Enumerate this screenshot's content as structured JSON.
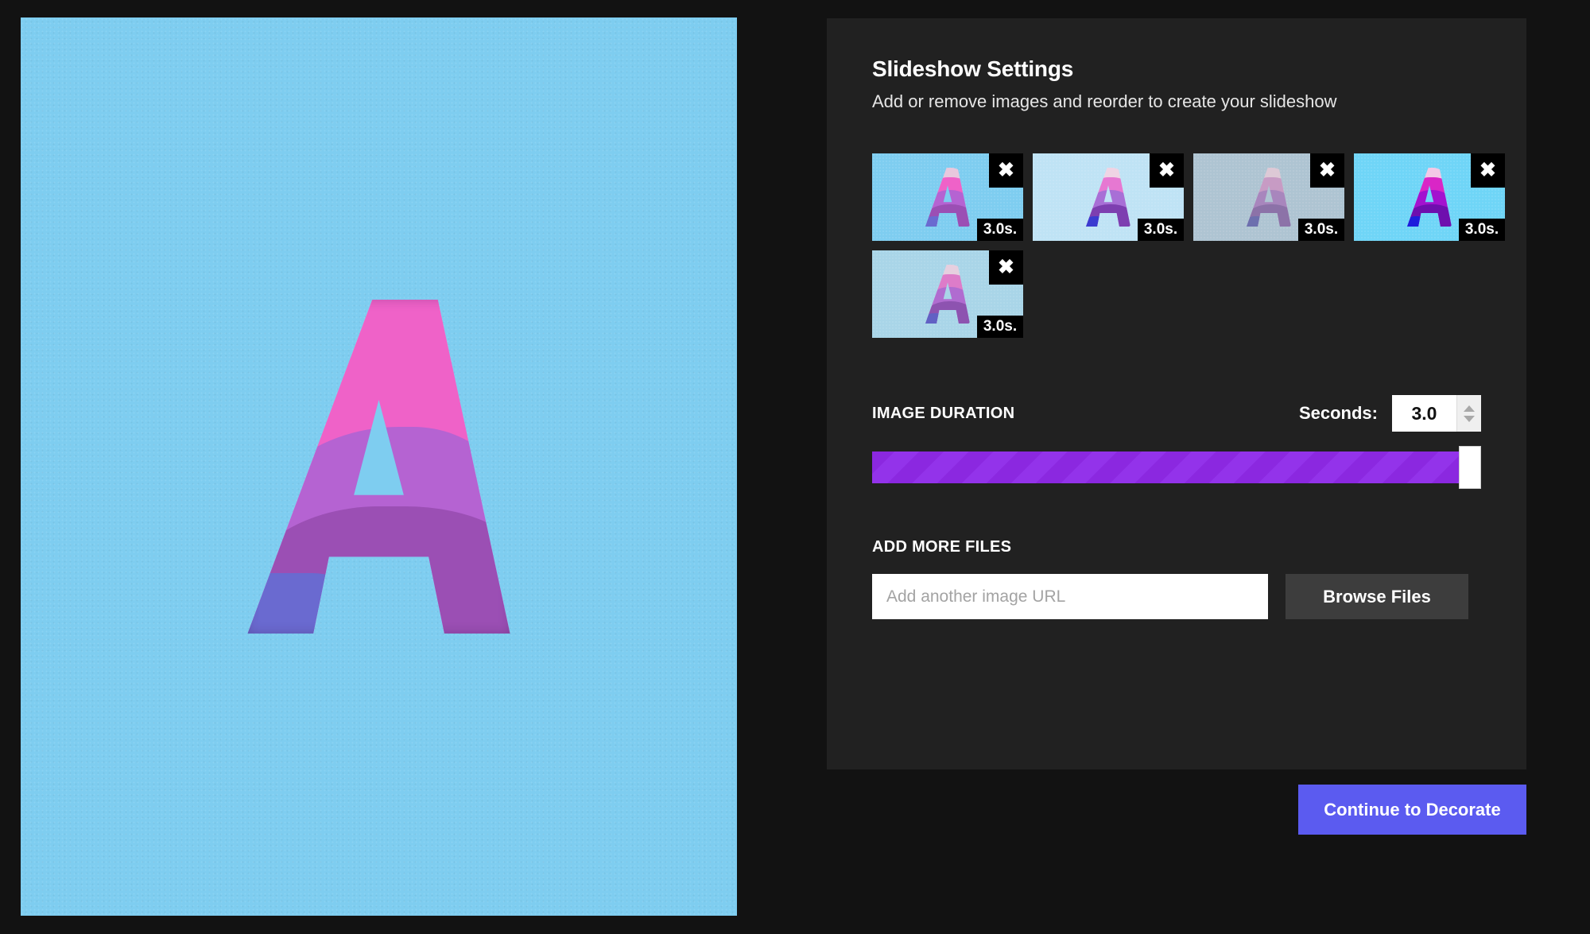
{
  "preview": {
    "alt_name": "letter-A-papercut-artwork",
    "background_color": "#7ecdf0"
  },
  "panel": {
    "title": "Slideshow Settings",
    "subtitle": "Add or remove images and reorder to create your slideshow",
    "background_color": "#212121"
  },
  "thumbnails": [
    {
      "duration_label": "3.0s.",
      "remove_icon": "close-icon",
      "remove_glyph": "✖",
      "background_color": "#7ecdf0",
      "letter": "A",
      "style": "bright-cyan"
    },
    {
      "duration_label": "3.0s.",
      "remove_icon": "close-icon",
      "remove_glyph": "✖",
      "background_color": "#bfe3f5",
      "letter": "A",
      "style": "pale-blue"
    },
    {
      "duration_label": "3.0s.",
      "remove_icon": "close-icon",
      "remove_glyph": "✖",
      "background_color": "#aec4d2",
      "letter": "A",
      "style": "desaturated-grey-blue"
    },
    {
      "duration_label": "3.0s.",
      "remove_icon": "close-icon",
      "remove_glyph": "✖",
      "background_color": "#6fd5f7",
      "letter": "A",
      "style": "vivid-saturated"
    },
    {
      "duration_label": "3.0s.",
      "remove_icon": "close-icon",
      "remove_glyph": "✖",
      "background_color": "#a9d5e8",
      "letter": "A",
      "style": "muted-blue"
    }
  ],
  "duration": {
    "section_label": "IMAGE DURATION",
    "seconds_label": "Seconds:",
    "seconds_value": "3.0",
    "spinner_up_icon": "caret-up-icon",
    "spinner_down_icon": "caret-down-icon",
    "slider_fill_percent": 100,
    "slider_color": "#9333ea"
  },
  "add_files": {
    "section_label": "ADD MORE FILES",
    "url_placeholder": "Add another image URL",
    "url_value": "",
    "browse_label": "Browse Files"
  },
  "footer": {
    "continue_label": "Continue to Decorate",
    "continue_color": "#5b5bf0"
  }
}
